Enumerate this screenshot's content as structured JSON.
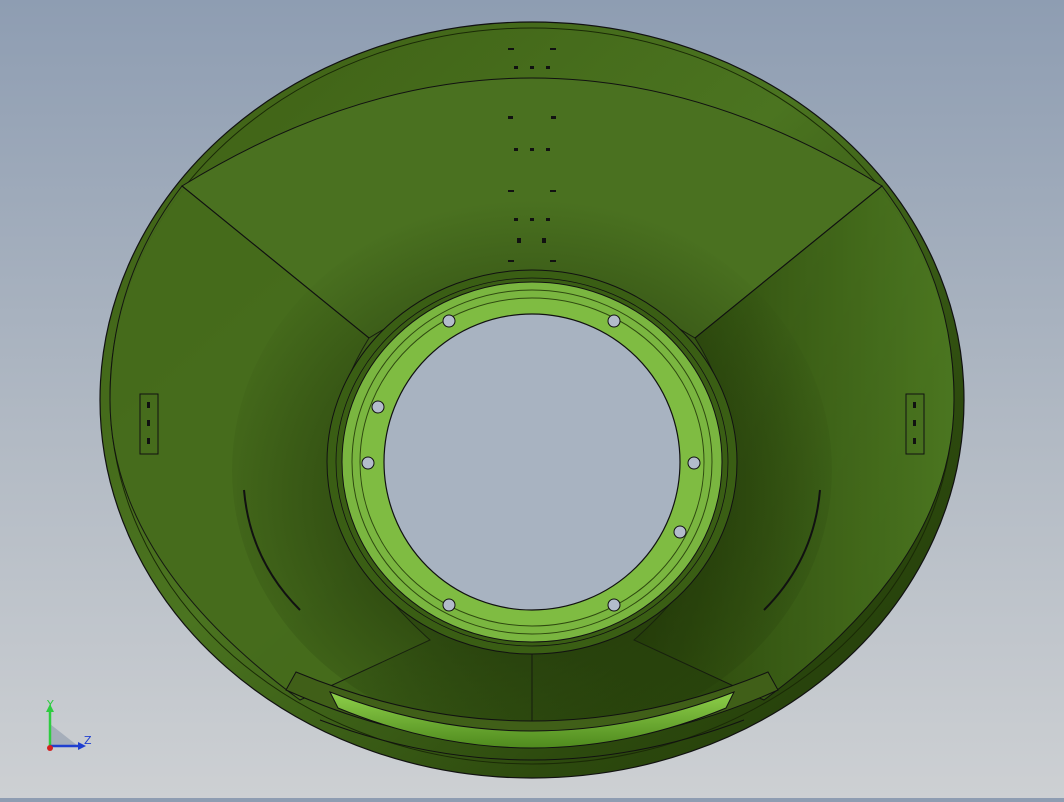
{
  "viewport": {
    "background_top": "#8e9db2",
    "background_bottom": "#cdd0d3",
    "part_color_dark": "#2f4a10",
    "part_color_mid": "#4a6f1c",
    "part_color_light": "#76b03a",
    "flange_color": "#7ab640"
  },
  "triad": {
    "y_label": "Y",
    "z_label": "Z",
    "y_color": "#2ecc40",
    "z_color": "#1f3fd0",
    "x_color": "#d42020"
  }
}
